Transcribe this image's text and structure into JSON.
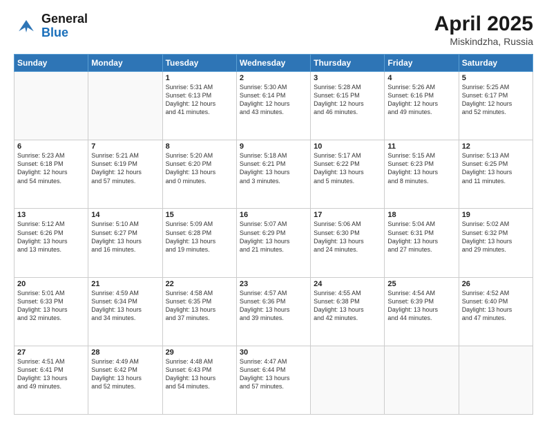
{
  "header": {
    "logo_line1": "General",
    "logo_line2": "Blue",
    "month_year": "April 2025",
    "location": "Miskindzha, Russia"
  },
  "days_of_week": [
    "Sunday",
    "Monday",
    "Tuesday",
    "Wednesday",
    "Thursday",
    "Friday",
    "Saturday"
  ],
  "weeks": [
    [
      {
        "num": "",
        "info": ""
      },
      {
        "num": "",
        "info": ""
      },
      {
        "num": "1",
        "info": "Sunrise: 5:31 AM\nSunset: 6:13 PM\nDaylight: 12 hours\nand 41 minutes."
      },
      {
        "num": "2",
        "info": "Sunrise: 5:30 AM\nSunset: 6:14 PM\nDaylight: 12 hours\nand 43 minutes."
      },
      {
        "num": "3",
        "info": "Sunrise: 5:28 AM\nSunset: 6:15 PM\nDaylight: 12 hours\nand 46 minutes."
      },
      {
        "num": "4",
        "info": "Sunrise: 5:26 AM\nSunset: 6:16 PM\nDaylight: 12 hours\nand 49 minutes."
      },
      {
        "num": "5",
        "info": "Sunrise: 5:25 AM\nSunset: 6:17 PM\nDaylight: 12 hours\nand 52 minutes."
      }
    ],
    [
      {
        "num": "6",
        "info": "Sunrise: 5:23 AM\nSunset: 6:18 PM\nDaylight: 12 hours\nand 54 minutes."
      },
      {
        "num": "7",
        "info": "Sunrise: 5:21 AM\nSunset: 6:19 PM\nDaylight: 12 hours\nand 57 minutes."
      },
      {
        "num": "8",
        "info": "Sunrise: 5:20 AM\nSunset: 6:20 PM\nDaylight: 13 hours\nand 0 minutes."
      },
      {
        "num": "9",
        "info": "Sunrise: 5:18 AM\nSunset: 6:21 PM\nDaylight: 13 hours\nand 3 minutes."
      },
      {
        "num": "10",
        "info": "Sunrise: 5:17 AM\nSunset: 6:22 PM\nDaylight: 13 hours\nand 5 minutes."
      },
      {
        "num": "11",
        "info": "Sunrise: 5:15 AM\nSunset: 6:23 PM\nDaylight: 13 hours\nand 8 minutes."
      },
      {
        "num": "12",
        "info": "Sunrise: 5:13 AM\nSunset: 6:25 PM\nDaylight: 13 hours\nand 11 minutes."
      }
    ],
    [
      {
        "num": "13",
        "info": "Sunrise: 5:12 AM\nSunset: 6:26 PM\nDaylight: 13 hours\nand 13 minutes."
      },
      {
        "num": "14",
        "info": "Sunrise: 5:10 AM\nSunset: 6:27 PM\nDaylight: 13 hours\nand 16 minutes."
      },
      {
        "num": "15",
        "info": "Sunrise: 5:09 AM\nSunset: 6:28 PM\nDaylight: 13 hours\nand 19 minutes."
      },
      {
        "num": "16",
        "info": "Sunrise: 5:07 AM\nSunset: 6:29 PM\nDaylight: 13 hours\nand 21 minutes."
      },
      {
        "num": "17",
        "info": "Sunrise: 5:06 AM\nSunset: 6:30 PM\nDaylight: 13 hours\nand 24 minutes."
      },
      {
        "num": "18",
        "info": "Sunrise: 5:04 AM\nSunset: 6:31 PM\nDaylight: 13 hours\nand 27 minutes."
      },
      {
        "num": "19",
        "info": "Sunrise: 5:02 AM\nSunset: 6:32 PM\nDaylight: 13 hours\nand 29 minutes."
      }
    ],
    [
      {
        "num": "20",
        "info": "Sunrise: 5:01 AM\nSunset: 6:33 PM\nDaylight: 13 hours\nand 32 minutes."
      },
      {
        "num": "21",
        "info": "Sunrise: 4:59 AM\nSunset: 6:34 PM\nDaylight: 13 hours\nand 34 minutes."
      },
      {
        "num": "22",
        "info": "Sunrise: 4:58 AM\nSunset: 6:35 PM\nDaylight: 13 hours\nand 37 minutes."
      },
      {
        "num": "23",
        "info": "Sunrise: 4:57 AM\nSunset: 6:36 PM\nDaylight: 13 hours\nand 39 minutes."
      },
      {
        "num": "24",
        "info": "Sunrise: 4:55 AM\nSunset: 6:38 PM\nDaylight: 13 hours\nand 42 minutes."
      },
      {
        "num": "25",
        "info": "Sunrise: 4:54 AM\nSunset: 6:39 PM\nDaylight: 13 hours\nand 44 minutes."
      },
      {
        "num": "26",
        "info": "Sunrise: 4:52 AM\nSunset: 6:40 PM\nDaylight: 13 hours\nand 47 minutes."
      }
    ],
    [
      {
        "num": "27",
        "info": "Sunrise: 4:51 AM\nSunset: 6:41 PM\nDaylight: 13 hours\nand 49 minutes."
      },
      {
        "num": "28",
        "info": "Sunrise: 4:49 AM\nSunset: 6:42 PM\nDaylight: 13 hours\nand 52 minutes."
      },
      {
        "num": "29",
        "info": "Sunrise: 4:48 AM\nSunset: 6:43 PM\nDaylight: 13 hours\nand 54 minutes."
      },
      {
        "num": "30",
        "info": "Sunrise: 4:47 AM\nSunset: 6:44 PM\nDaylight: 13 hours\nand 57 minutes."
      },
      {
        "num": "",
        "info": ""
      },
      {
        "num": "",
        "info": ""
      },
      {
        "num": "",
        "info": ""
      }
    ]
  ]
}
